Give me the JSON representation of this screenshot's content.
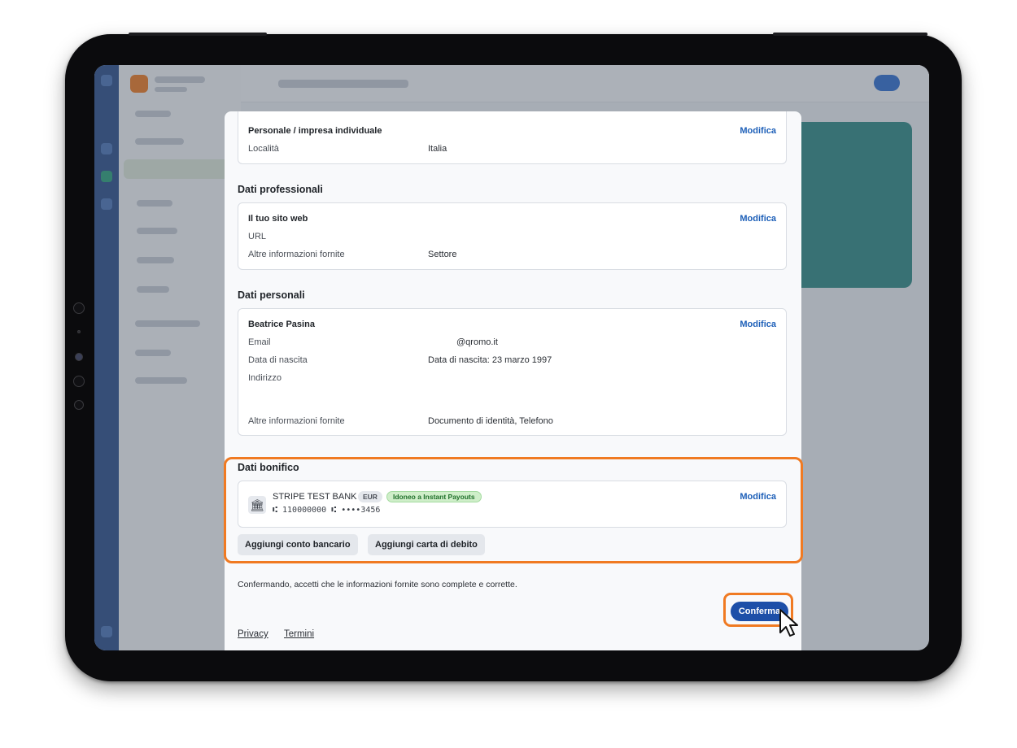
{
  "colors": {
    "accent": "#1d4fa8",
    "link": "#1d5fb8",
    "highlight": "#f07a22",
    "instant_badge": "#cfeec9"
  },
  "sections": {
    "entity": {
      "title": "Personale / impresa individuale",
      "edit": "Modifica",
      "rows": [
        {
          "label": "Località",
          "value": "Italia"
        }
      ]
    },
    "professional": {
      "heading": "Dati professionali",
      "card_title": "Il tuo sito web",
      "edit": "Modifica",
      "rows": [
        {
          "label": "URL",
          "value": ""
        },
        {
          "label": "Altre informazioni fornite",
          "value": "Settore"
        }
      ]
    },
    "personal": {
      "heading": "Dati personali",
      "card_title": "Beatrice Pasina",
      "edit": "Modifica",
      "rows": [
        {
          "label": "Email",
          "value": "@qromo.it"
        },
        {
          "label": "Data di nascita",
          "value": "Data di nascita: 23 marzo 1997"
        },
        {
          "label": "Indirizzo",
          "value": ""
        },
        {
          "label": "Altre informazioni fornite",
          "value": "Documento di identità, Telefono"
        }
      ]
    },
    "bank": {
      "heading": "Dati bonifico",
      "bank_name": "STRIPE TEST BANK",
      "currency_badge": "EUR",
      "instant_badge": "Idoneo a Instant Payouts",
      "account_number": "⑆ 110000000 ⑆ ••••3456",
      "edit": "Modifica",
      "icon": "bank-icon",
      "add_bank_button": "Aggiungi conto bancario",
      "add_card_button": "Aggiungi carta di debito"
    }
  },
  "footer": {
    "consent_text": "Confermando, accetti che le informazioni fornite sono complete e corrette.",
    "confirm_button": "Conferma",
    "privacy_link": "Privacy",
    "terms_link": "Termini"
  }
}
